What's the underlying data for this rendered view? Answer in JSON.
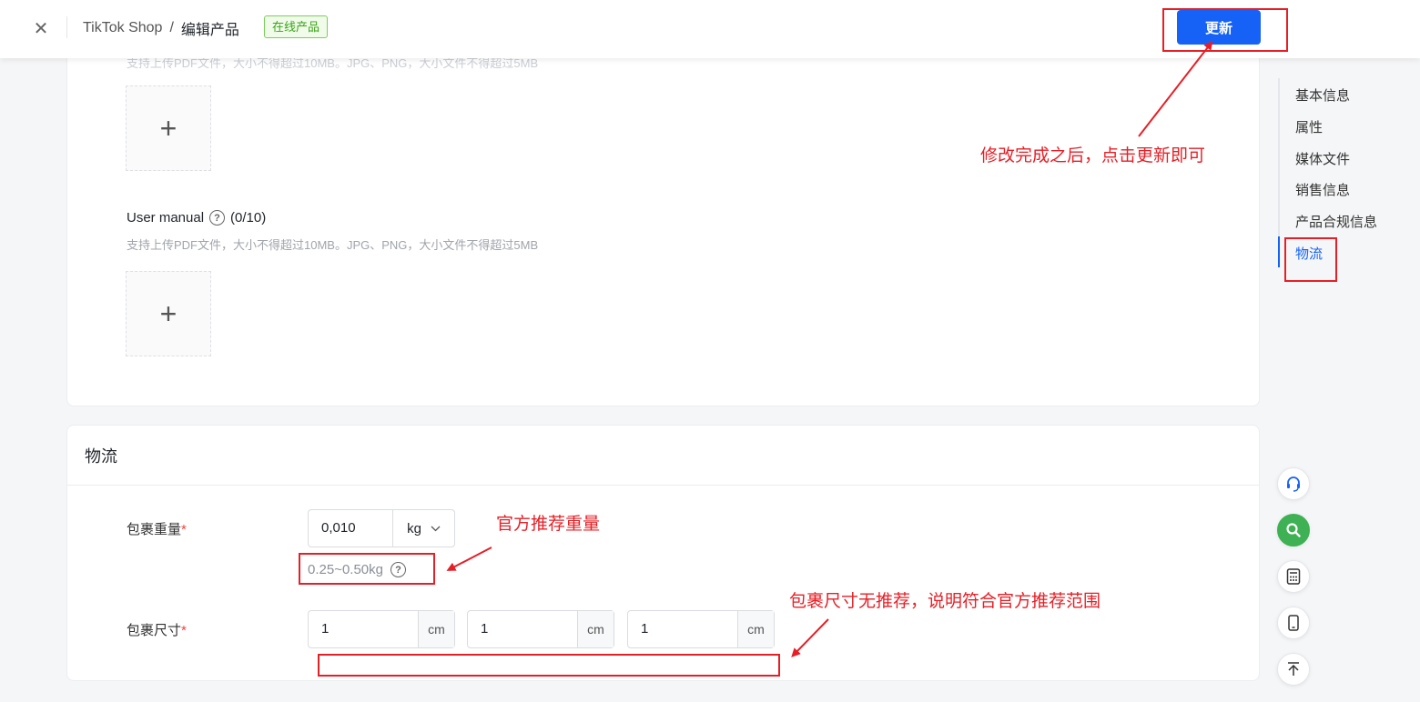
{
  "topbar": {
    "close_glyph": "✕",
    "breadcrumb_root": "TikTok Shop",
    "breadcrumb_sep": "/",
    "breadcrumb_current": "编辑产品",
    "status_badge": "在线产品",
    "update_label": "更新"
  },
  "media": {
    "faded_hint": "支持上传PDF文件，大小不得超过10MB。JPG、PNG，大小文件不得超过5MB",
    "upload_plus": "+",
    "manual_label": "User manual",
    "manual_count": "(0/10)",
    "manual_hint": "支持上传PDF文件，大小不得超过10MB。JPG、PNG，大小文件不得超过5MB"
  },
  "logistics": {
    "title": "物流",
    "weight_label": "包裹重量",
    "required_mark": "*",
    "weight_value": "0,010",
    "weight_unit": "kg",
    "weight_range": "0.25~0.50kg",
    "size_label": "包裹尺寸",
    "size_values": [
      "1",
      "1",
      "1"
    ],
    "size_unit": "cm"
  },
  "anchor_nav": {
    "items": [
      "基本信息",
      "属性",
      "媒体文件",
      "销售信息",
      "产品合规信息",
      "物流"
    ],
    "active_index": 5
  },
  "float_tools": [
    "headset-icon",
    "search-icon",
    "calculator-icon",
    "mobile-icon",
    "back-to-top-icon"
  ],
  "annotations": {
    "update_tip": "修改完成之后，点击更新即可",
    "weight_tip": "官方推荐重量",
    "size_tip": "包裹尺寸无推荐，说明符合官方推荐范围"
  },
  "colors": {
    "primary": "#1662f6",
    "annotation_red": "#e61f26",
    "badge_green": "#3aa517",
    "required_red": "#f53f3f",
    "tool_green": "#3db153"
  }
}
